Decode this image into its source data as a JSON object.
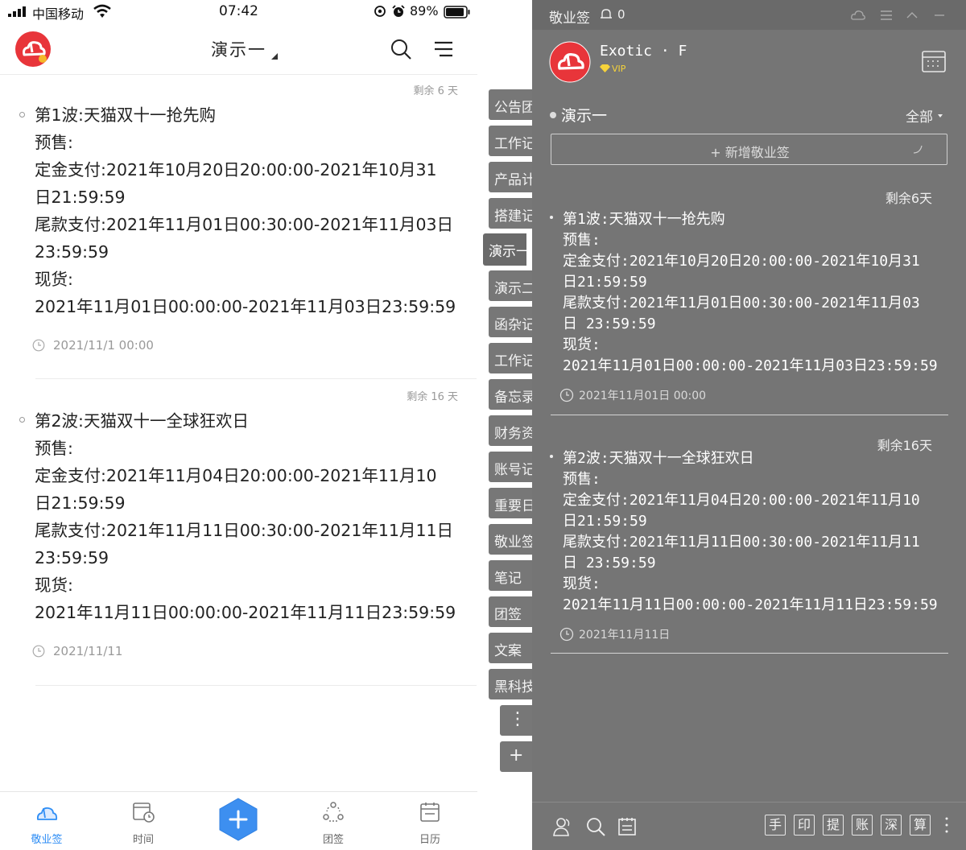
{
  "status_bar": {
    "carrier": "中国移动",
    "time": "07:42",
    "battery": "89%"
  },
  "mobile": {
    "title": "演示一",
    "cards": [
      {
        "remain": "剩余 6 天",
        "lines": [
          "第1波:天猫双十一抢先购",
          "预售:",
          "定金支付:2021年10月20日20:00:00-2021年10月31",
          "日21:59:59",
          "尾款支付:2021年11月01日00:30:00-2021年11月03日",
          "23:59:59",
          "现货:",
          "2021年11月01日00:00:00-2021年11月03日23:59:59"
        ],
        "date": "2021/11/1 00:00"
      },
      {
        "remain": "剩余 16 天",
        "lines": [
          "第2波:天猫双十一全球狂欢日",
          "预售:",
          "定金支付:2021年11月04日20:00:00-2021年11月10",
          "日21:59:59",
          "尾款支付:2021年11月11日00:30:00-2021年11月11日",
          "23:59:59",
          "现货:",
          "2021年11月11日00:00:00-2021年11月11日23:59:59"
        ],
        "date": "2021/11/11"
      }
    ],
    "tabs": [
      {
        "label": "敬业签",
        "icon": "cloud-icon"
      },
      {
        "label": "时间",
        "icon": "time-icon"
      },
      {
        "label": "团签",
        "icon": "team-icon"
      },
      {
        "label": "日历",
        "icon": "calendar-icon"
      }
    ]
  },
  "side_tabs": [
    "公告团",
    "工作记",
    "产品计",
    "搭建记",
    "演示一",
    "演示二",
    "函杂记",
    "工作记",
    "备忘录",
    "财务资",
    "账号记",
    "重要日",
    "敬业签",
    "笔记",
    "团签",
    "文案",
    "黑科技"
  ],
  "side_tab_actions": {
    "more": "⋮",
    "add": "+"
  },
  "desktop": {
    "app_name": "敬业签",
    "bell_count": "0",
    "user_name": "Exotic · F",
    "vip": "VIP",
    "category": "演示一",
    "filter": "全部",
    "add_placeholder": "+ 新增敬业签",
    "cards": [
      {
        "remain": "剩余6天",
        "lines": [
          "第1波:天猫双十一抢先购",
          "预售:",
          "定金支付:2021年10月20日20:00:00-2021年10月31",
          "日21:59:59",
          "尾款支付:2021年11月01日00:30:00-2021年11月03",
          "日 23:59:59",
          "现货:",
          "2021年11月01日00:00:00-2021年11月03日23:59:59"
        ],
        "date": "2021年11月01日  00:00"
      },
      {
        "remain": "剩余16天",
        "lines": [
          "第2波:天猫双十一全球狂欢日",
          "预售:",
          "定金支付:2021年11月04日20:00:00-2021年11月10",
          "日21:59:59",
          "尾款支付:2021年11月11日00:30:00-2021年11月11",
          "日 23:59:59",
          "现货:",
          "2021年11月11日00:00:00-2021年11月11日23:59:59"
        ],
        "date": "2021年11月11日"
      }
    ],
    "bottom_buttons": [
      "手",
      "印",
      "提",
      "账",
      "深",
      "算"
    ]
  }
}
